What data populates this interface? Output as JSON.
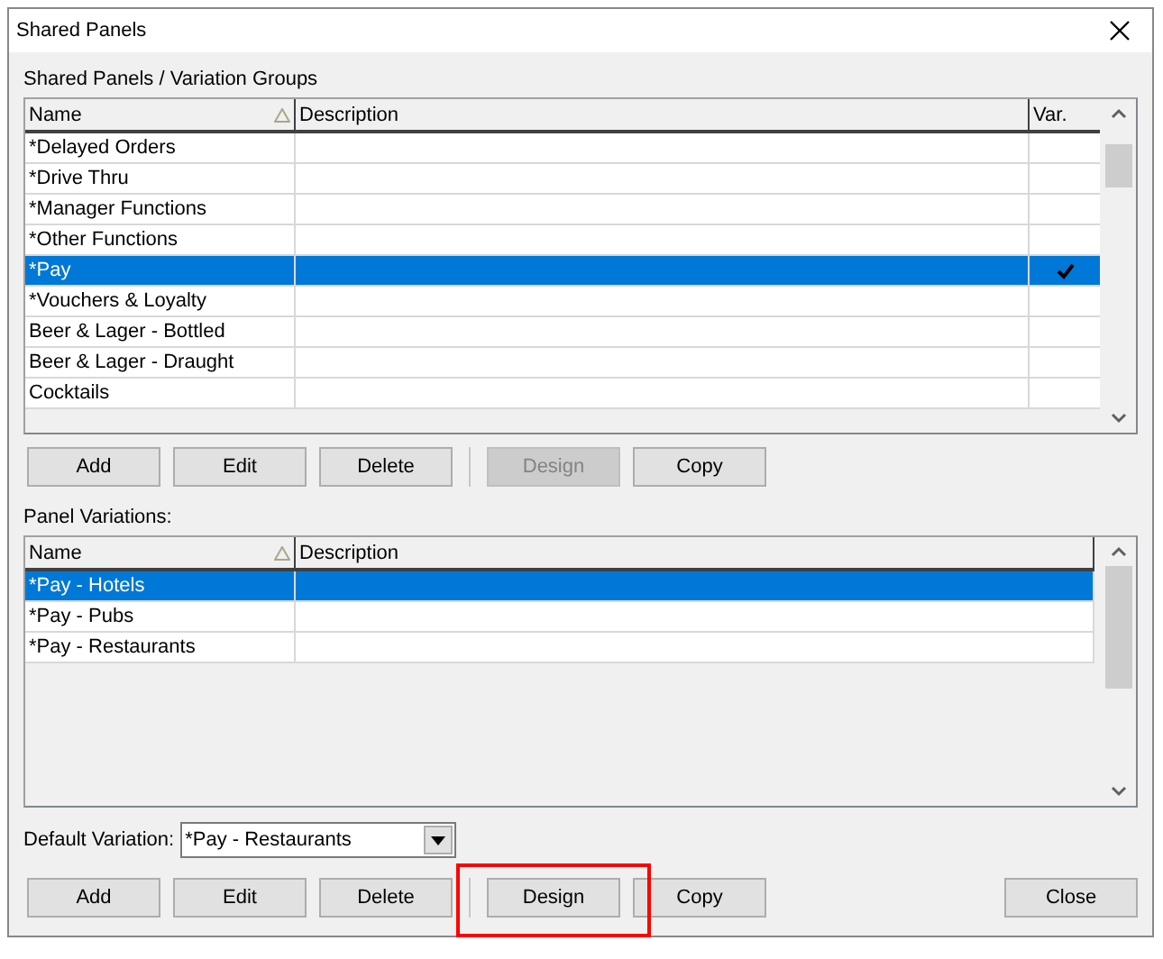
{
  "window": {
    "title": "Shared Panels"
  },
  "groups": {
    "label": "Shared Panels / Variation Groups",
    "columns": [
      {
        "label": "Name",
        "sorted": true
      },
      {
        "label": "Description",
        "sorted": false
      },
      {
        "label": "Var.",
        "sorted": false
      }
    ],
    "rows": [
      {
        "name": "*Delayed Orders",
        "selected": false,
        "has_variations": false
      },
      {
        "name": "*Drive Thru",
        "selected": false,
        "has_variations": false
      },
      {
        "name": "*Manager Functions",
        "selected": false,
        "has_variations": false
      },
      {
        "name": "*Other Functions",
        "selected": false,
        "has_variations": false
      },
      {
        "name": "*Pay",
        "selected": true,
        "has_variations": true
      },
      {
        "name": "*Vouchers & Loyalty",
        "selected": false,
        "has_variations": false
      },
      {
        "name": "Beer & Lager - Bottled",
        "selected": false,
        "has_variations": false
      },
      {
        "name": "Beer & Lager - Draught",
        "selected": false,
        "has_variations": false
      },
      {
        "name": "Cocktails",
        "selected": false,
        "has_variations": false
      }
    ]
  },
  "group_buttons": [
    [
      {
        "label": "Add",
        "disabled": false,
        "highlighted": false
      },
      {
        "label": "Edit",
        "disabled": false,
        "highlighted": false
      },
      {
        "label": "Delete",
        "disabled": false,
        "highlighted": false
      }
    ],
    [
      {
        "label": "Design",
        "disabled": true,
        "highlighted": false
      },
      {
        "label": "Copy",
        "disabled": false,
        "highlighted": false
      }
    ]
  ],
  "variations": {
    "label": "Panel Variations:",
    "columns": [
      {
        "label": "Name",
        "sorted": true
      },
      {
        "label": "Description",
        "sorted": false
      }
    ],
    "rows": [
      {
        "name": "*Pay - Hotels",
        "selected": true
      },
      {
        "name": "*Pay - Pubs",
        "selected": false
      },
      {
        "name": "*Pay - Restaurants",
        "selected": false
      }
    ]
  },
  "default_variation": {
    "label": "Default Variation:",
    "value": "*Pay - Restaurants"
  },
  "variation_buttons": [
    [
      {
        "label": "Add",
        "disabled": false,
        "highlighted": false
      },
      {
        "label": "Edit",
        "disabled": false,
        "highlighted": false
      },
      {
        "label": "Delete",
        "disabled": false,
        "highlighted": false
      }
    ],
    [
      {
        "label": "Design",
        "disabled": false,
        "highlighted": true
      },
      {
        "label": "Copy",
        "disabled": false,
        "highlighted": false
      }
    ]
  ],
  "close_button": {
    "label": "Close"
  }
}
